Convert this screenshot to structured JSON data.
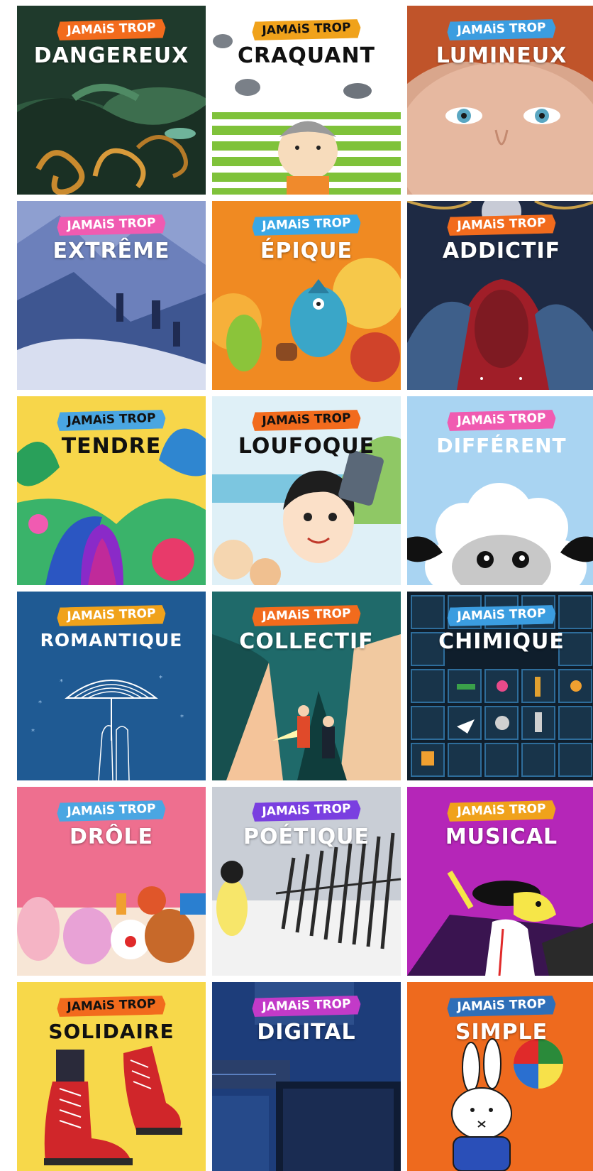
{
  "tag_text": "JAMAiS TROP",
  "tiles": [
    {
      "word": "DANGEREUX",
      "tag_bg": "#f26b1d",
      "tag_fg": "#ffffff",
      "word_color": "#ffffff"
    },
    {
      "word": "CRAQUANT",
      "tag_bg": "#f0a21b",
      "tag_fg": "#111111",
      "word_color": "#111111"
    },
    {
      "word": "LUMINEUX",
      "tag_bg": "#3b9de0",
      "tag_fg": "#ffffff",
      "word_color": "#ffffff"
    },
    {
      "word": "EXTRÊME",
      "tag_bg": "#f05bb1",
      "tag_fg": "#ffffff",
      "word_color": "#ffffff"
    },
    {
      "word": "ÉPIQUE",
      "tag_bg": "#3aa7e5",
      "tag_fg": "#ffffff",
      "word_color": "#ffffff"
    },
    {
      "word": "ADDICTIF",
      "tag_bg": "#f26b1d",
      "tag_fg": "#ffffff",
      "word_color": "#ffffff"
    },
    {
      "word": "TENDRE",
      "tag_bg": "#4aa6e2",
      "tag_fg": "#111111",
      "word_color": "#111111"
    },
    {
      "word": "LOUFOQUE",
      "tag_bg": "#f26b1d",
      "tag_fg": "#111111",
      "word_color": "#111111"
    },
    {
      "word": "DIFFÉRENT",
      "tag_bg": "#f05bb1",
      "tag_fg": "#ffffff",
      "word_color": "#ffffff"
    },
    {
      "word": "ROMANTIQUE",
      "tag_bg": "#f0a21b",
      "tag_fg": "#ffffff",
      "word_color": "#ffffff"
    },
    {
      "word": "COLLECTIF",
      "tag_bg": "#f26b1d",
      "tag_fg": "#ffffff",
      "word_color": "#ffffff"
    },
    {
      "word": "CHIMIQUE",
      "tag_bg": "#3b9de0",
      "tag_fg": "#ffffff",
      "word_color": "#ffffff"
    },
    {
      "word": "DRÔLE",
      "tag_bg": "#4aa6e2",
      "tag_fg": "#ffffff",
      "word_color": "#ffffff"
    },
    {
      "word": "POÉTIQUE",
      "tag_bg": "#7a3fe0",
      "tag_fg": "#ffffff",
      "word_color": "#ffffff"
    },
    {
      "word": "MUSICAL",
      "tag_bg": "#f0a21b",
      "tag_fg": "#ffffff",
      "word_color": "#ffffff"
    },
    {
      "word": "SOLIDAIRE",
      "tag_bg": "#f26b1d",
      "tag_fg": "#111111",
      "word_color": "#111111"
    },
    {
      "word": "DIGITAL",
      "tag_bg": "#c23ac8",
      "tag_fg": "#ffffff",
      "word_color": "#ffffff"
    },
    {
      "word": "SIMPLE",
      "tag_bg": "#2f6fb8",
      "tag_fg": "#ffffff",
      "word_color": "#ffffff"
    }
  ]
}
